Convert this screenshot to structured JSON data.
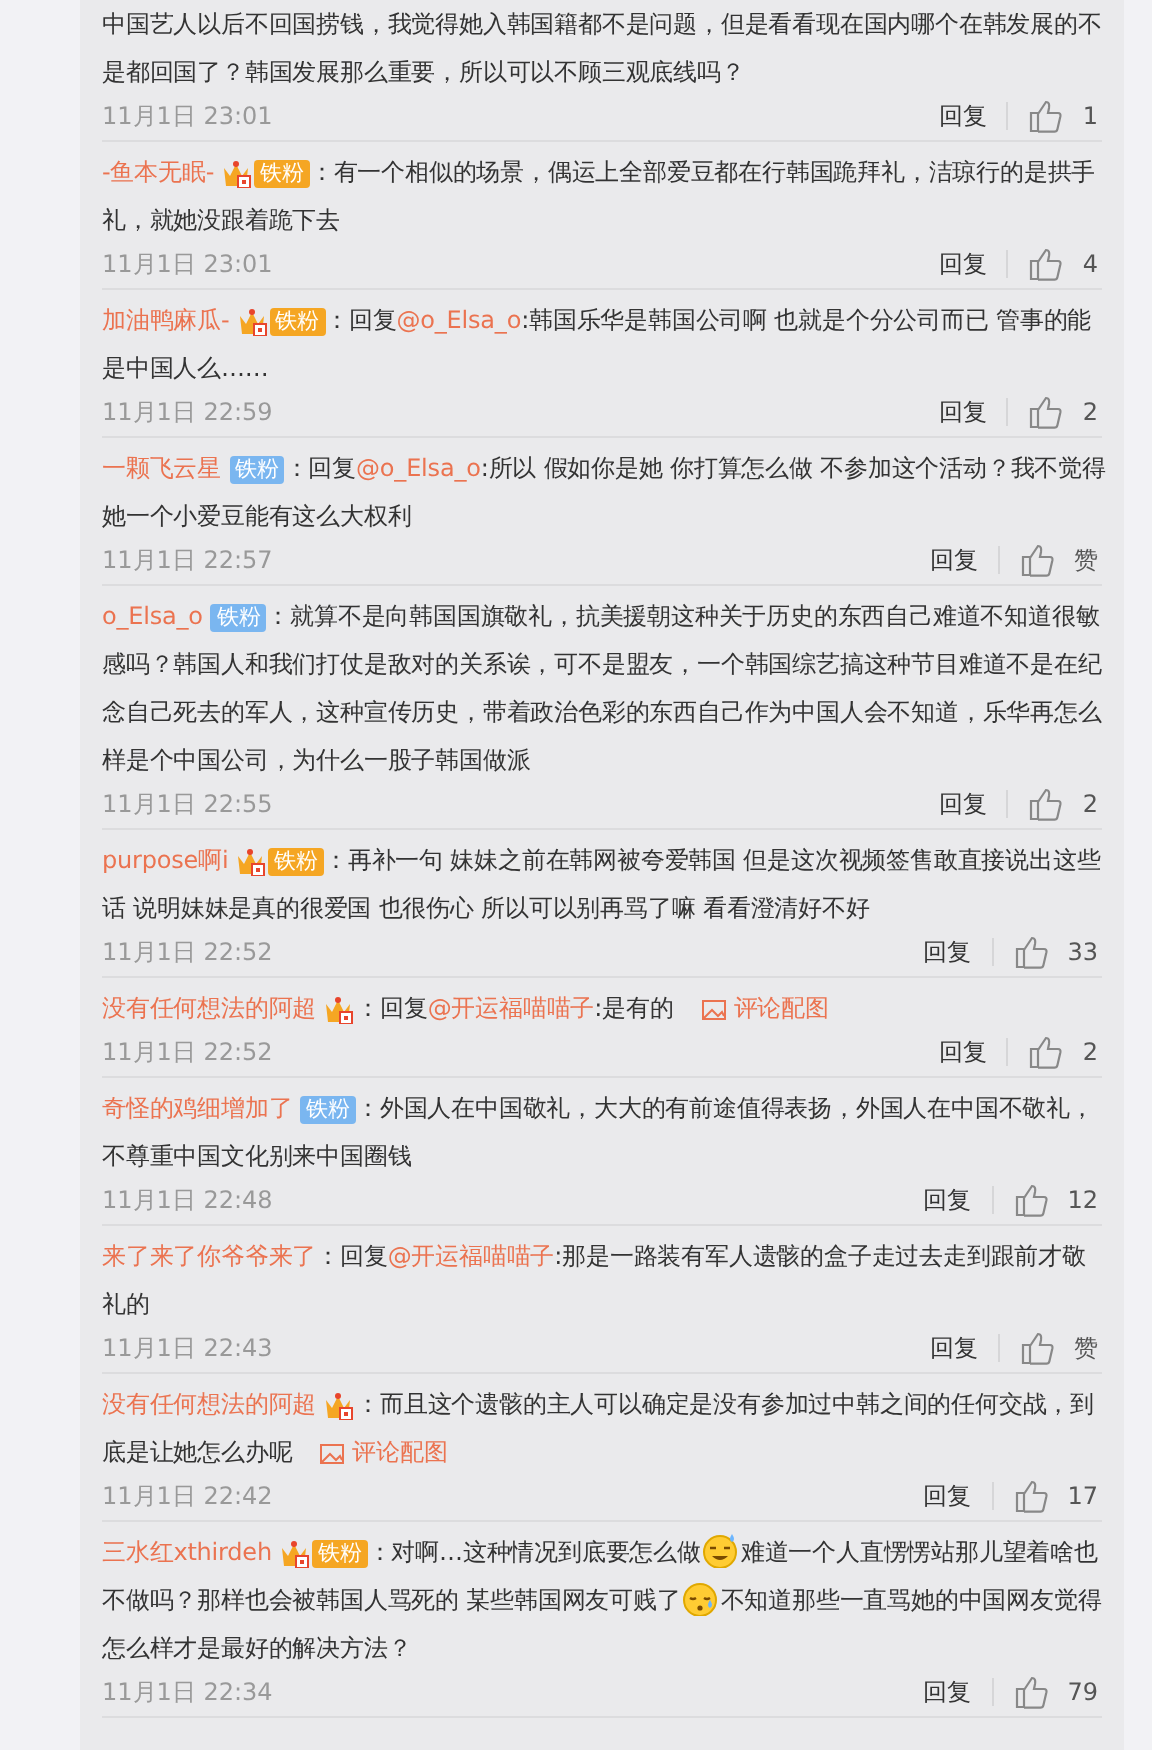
{
  "comments": [
    {
      "body": [
        {
          "kind": "text",
          "text": "中国艺人以后不回国捞钱，我觉得她入韩国籍都不是问题，但是看看现在国内哪个在韩发展的不是都回国了？韩国发展那么重要，所以可以不顾三观底线吗？"
        }
      ],
      "time": "11月1日 23:01",
      "reply": "回复",
      "likes": "1"
    },
    {
      "user": "-鱼本无眠-",
      "badges": [
        {
          "kind": "crown"
        },
        {
          "kind": "fan-gold",
          "label": "铁粉"
        }
      ],
      "body": [
        {
          "kind": "text",
          "text": "：有一个相似的场景，偶运上全部爱豆都在行韩国跪拜礼，洁琼行的是拱手礼，就她没跟着跪下去"
        }
      ],
      "time": "11月1日 23:01",
      "reply": "回复",
      "likes": "4"
    },
    {
      "user": "加油鸭麻瓜-",
      "badges": [
        {
          "kind": "crown"
        },
        {
          "kind": "fan-gold",
          "label": "铁粉"
        }
      ],
      "body": [
        {
          "kind": "text",
          "text": "：回复"
        },
        {
          "kind": "mention",
          "text": "@o_Elsa_o"
        },
        {
          "kind": "text",
          "text": ":韩国乐华是韩国公司啊 也就是个分公司而已 管事的能是中国人么……"
        }
      ],
      "time": "11月1日 22:59",
      "reply": "回复",
      "likes": "2"
    },
    {
      "user": "一颗飞云星",
      "badges": [
        {
          "kind": "fan-blue",
          "label": "铁粉"
        }
      ],
      "body": [
        {
          "kind": "text",
          "text": "：回复"
        },
        {
          "kind": "mention",
          "text": "@o_Elsa_o"
        },
        {
          "kind": "text",
          "text": ":所以 假如你是她 你打算怎么做 不参加这个活动？我不觉得她一个小爱豆能有这么大权利"
        }
      ],
      "time": "11月1日 22:57",
      "reply": "回复",
      "likes": "赞"
    },
    {
      "user": "o_Elsa_o",
      "badges": [
        {
          "kind": "fan-blue",
          "label": "铁粉"
        }
      ],
      "body": [
        {
          "kind": "text",
          "text": "：就算不是向韩国国旗敬礼，抗美援朝这种关于历史的东西自己难道不知道很敏感吗？韩国人和我们打仗是敌对的关系诶，可不是盟友，一个韩国综艺搞这种节目难道不是在纪念自己死去的军人，这种宣传历史，带着政治色彩的东西自己作为中国人会不知道，乐华再怎么样是个中国公司，为什么一股子韩国做派"
        }
      ],
      "time": "11月1日 22:55",
      "reply": "回复",
      "likes": "2"
    },
    {
      "user": "purpose啊i",
      "badges": [
        {
          "kind": "crown"
        },
        {
          "kind": "fan-gold",
          "label": "铁粉"
        }
      ],
      "body": [
        {
          "kind": "text",
          "text": "：再补一句 妹妹之前在韩网被夸爱韩国 但是这次视频签售敢直接说出这些话 说明妹妹是真的很爱国 也很伤心 所以可以别再骂了嘛 看看澄清好不好"
        }
      ],
      "time": "11月1日 22:52",
      "reply": "回复",
      "likes": "33"
    },
    {
      "user": "没有任何想法的阿超",
      "badges": [
        {
          "kind": "crown"
        }
      ],
      "body": [
        {
          "kind": "text",
          "text": "：回复"
        },
        {
          "kind": "mention",
          "text": "@开运福喵喵子"
        },
        {
          "kind": "text",
          "text": ":是有的"
        }
      ],
      "image_link": "评论配图",
      "time": "11月1日 22:52",
      "reply": "回复",
      "likes": "2"
    },
    {
      "user": "奇怪的鸡细增加了",
      "badges": [
        {
          "kind": "fan-blue",
          "label": "铁粉"
        }
      ],
      "body": [
        {
          "kind": "text",
          "text": "：外国人在中国敬礼，大大的有前途值得表扬，外国人在中国不敬礼，不尊重中国文化别来中国圈钱"
        }
      ],
      "time": "11月1日 22:48",
      "reply": "回复",
      "likes": "12"
    },
    {
      "user": "来了来了你爷爷来了",
      "body": [
        {
          "kind": "text",
          "text": "：回复"
        },
        {
          "kind": "mention",
          "text": "@开运福喵喵子"
        },
        {
          "kind": "text",
          "text": ":那是一路装有军人遗骸的盒子走过去走到跟前才敬礼的"
        }
      ],
      "time": "11月1日 22:43",
      "reply": "回复",
      "likes": "赞"
    },
    {
      "user": "没有任何想法的阿超",
      "badges": [
        {
          "kind": "crown"
        }
      ],
      "body": [
        {
          "kind": "text",
          "text": "：而且这个遗骸的主人可以确定是没有参加过中韩之间的任何交战，到底是让她怎么办呢"
        }
      ],
      "image_link": "评论配图",
      "time": "11月1日 22:42",
      "reply": "回复",
      "likes": "17"
    },
    {
      "user": "三水红xthirdeh",
      "badges": [
        {
          "kind": "crown"
        },
        {
          "kind": "fan-gold",
          "label": "铁粉"
        }
      ],
      "body": [
        {
          "kind": "text",
          "text": "：对啊…这种情况到底要怎么做"
        },
        {
          "kind": "emoji-sweat"
        },
        {
          "kind": "text",
          "text": "难道一个人直愣愣站那儿望着啥也不做吗？那样也会被韩国人骂死的 某些韩国网友可贱了"
        },
        {
          "kind": "emoji-tear"
        },
        {
          "kind": "text",
          "text": "不知道那些一直骂她的中国网友觉得怎么样才是最好的解决方法？"
        }
      ],
      "time": "11月1日 22:34",
      "reply": "回复",
      "likes": "79"
    }
  ]
}
